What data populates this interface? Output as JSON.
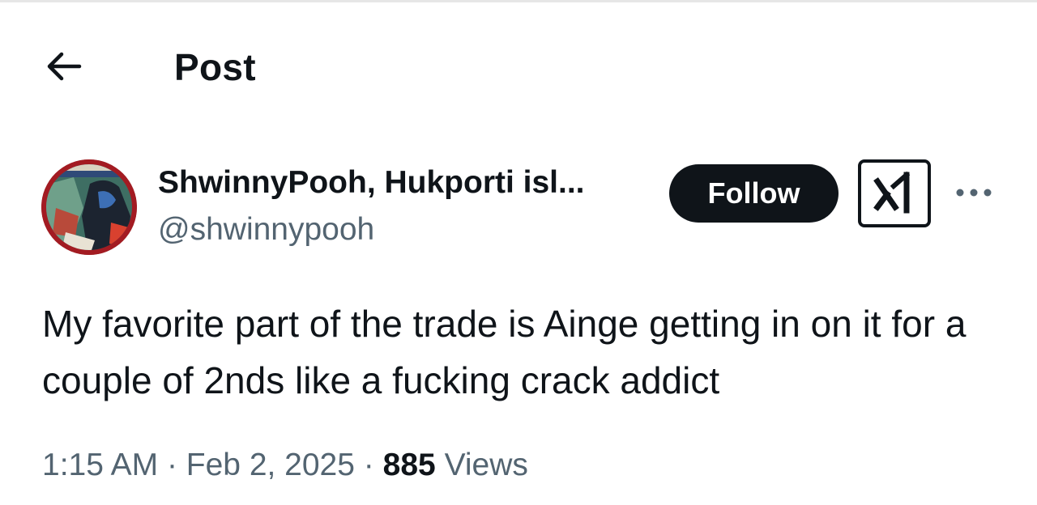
{
  "header": {
    "title": "Post",
    "back_icon": "arrow-left-icon"
  },
  "author": {
    "display_name": "ShwinnyPooh, Hukporti isl...",
    "handle": "@shwinnypooh",
    "avatar_icon": "user-avatar"
  },
  "actions": {
    "follow_label": "Follow",
    "grok_icon": "grok-icon",
    "more_icon": "more-horizontal-icon"
  },
  "post": {
    "text": "My favorite part of the trade is Ainge getting in on it for a couple of 2nds like a fucking crack addict"
  },
  "meta": {
    "time": "1:15 AM",
    "separator": "·",
    "date": "Feb 2, 2025",
    "views_count": "885",
    "views_label": "Views"
  },
  "colors": {
    "text_primary": "#0f1419",
    "text_secondary": "#536471",
    "button_dark": "#0f1419",
    "background": "#ffffff"
  }
}
